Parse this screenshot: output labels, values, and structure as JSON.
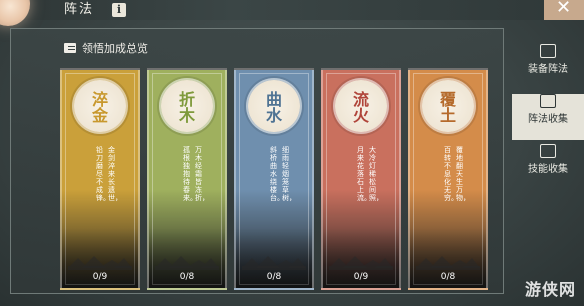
{
  "header": {
    "title": "阵法",
    "info_label": "i"
  },
  "overview": {
    "label": "领悟加成总览"
  },
  "cards": [
    {
      "name": "淬金",
      "poem": [
        "金剑淬来长遗世，",
        "铅刀磨尽不成锋。"
      ],
      "count": "0/9",
      "color": "#caa03a",
      "medal_color": "#c8982d"
    },
    {
      "name": "折木",
      "poem": [
        "万木经霜皆冻折，",
        "孤根独抱待春来。"
      ],
      "count": "0/8",
      "color": "#9fb05e",
      "medal_color": "#7f9a3c"
    },
    {
      "name": "曲水",
      "poem": [
        "细雨轻烟笼草树，",
        "斜桥曲水绕楼台。"
      ],
      "count": "0/8",
      "color": "#6f8fae",
      "medal_color": "#4f7393"
    },
    {
      "name": "流火",
      "poem": [
        "大冷灯稀松间照，",
        "月来花落石上流。"
      ],
      "count": "0/9",
      "color": "#c9705e",
      "medal_color": "#b0453a"
    },
    {
      "name": "覆土",
      "poem": [
        "覆地翻天生万物，",
        "百转不息化无穷。"
      ],
      "count": "0/8",
      "color": "#d48c4a",
      "medal_color": "#b56a2b"
    }
  ],
  "side_tabs": [
    {
      "label": "装备阵法",
      "icon": "formation-icon",
      "active": false
    },
    {
      "label": "阵法收集",
      "icon": "collection-icon",
      "active": true
    },
    {
      "label": "技能收集",
      "icon": "skill-icon",
      "active": false
    }
  ],
  "watermark": "游侠网"
}
